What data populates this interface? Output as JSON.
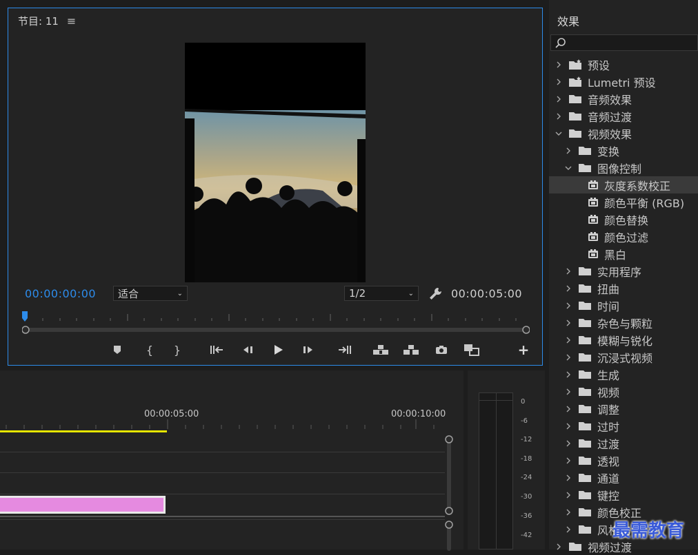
{
  "monitor": {
    "title": "节目: 11",
    "current_timecode": "00:00:00:00",
    "duration_timecode": "00:00:05:00",
    "fit_value": "适合",
    "resolution_value": "1/2"
  },
  "timeline": {
    "tick1": "00:00:05:00",
    "tick2": "00:00:10:00"
  },
  "meter": {
    "labels": [
      "0",
      "-6",
      "-12",
      "-18",
      "-24",
      "-30",
      "-36",
      "-42"
    ]
  },
  "effects": {
    "title": "效果",
    "items": [
      {
        "label": "预设",
        "level": 0,
        "arrow": "right",
        "icon": "star-folder"
      },
      {
        "label": "Lumetri 预设",
        "level": 0,
        "arrow": "right",
        "icon": "star-folder"
      },
      {
        "label": "音频效果",
        "level": 0,
        "arrow": "right",
        "icon": "folder"
      },
      {
        "label": "音频过渡",
        "level": 0,
        "arrow": "right",
        "icon": "folder"
      },
      {
        "label": "视频效果",
        "level": 0,
        "arrow": "down",
        "icon": "folder"
      },
      {
        "label": "变换",
        "level": 1,
        "arrow": "right",
        "icon": "folder"
      },
      {
        "label": "图像控制",
        "level": 1,
        "arrow": "down",
        "icon": "folder"
      },
      {
        "label": "灰度系数校正",
        "level": 2,
        "arrow": "",
        "icon": "effect",
        "selected": true
      },
      {
        "label": "颜色平衡 (RGB)",
        "level": 2,
        "arrow": "",
        "icon": "effect"
      },
      {
        "label": "颜色替换",
        "level": 2,
        "arrow": "",
        "icon": "effect"
      },
      {
        "label": "颜色过滤",
        "level": 2,
        "arrow": "",
        "icon": "effect"
      },
      {
        "label": "黑白",
        "level": 2,
        "arrow": "",
        "icon": "effect"
      },
      {
        "label": "实用程序",
        "level": 1,
        "arrow": "right",
        "icon": "folder"
      },
      {
        "label": "扭曲",
        "level": 1,
        "arrow": "right",
        "icon": "folder"
      },
      {
        "label": "时间",
        "level": 1,
        "arrow": "right",
        "icon": "folder"
      },
      {
        "label": "杂色与颗粒",
        "level": 1,
        "arrow": "right",
        "icon": "folder"
      },
      {
        "label": "模糊与锐化",
        "level": 1,
        "arrow": "right",
        "icon": "folder"
      },
      {
        "label": "沉浸式视频",
        "level": 1,
        "arrow": "right",
        "icon": "folder"
      },
      {
        "label": "生成",
        "level": 1,
        "arrow": "right",
        "icon": "folder"
      },
      {
        "label": "视频",
        "level": 1,
        "arrow": "right",
        "icon": "folder"
      },
      {
        "label": "调整",
        "level": 1,
        "arrow": "right",
        "icon": "folder"
      },
      {
        "label": "过时",
        "level": 1,
        "arrow": "right",
        "icon": "folder"
      },
      {
        "label": "过渡",
        "level": 1,
        "arrow": "right",
        "icon": "folder"
      },
      {
        "label": "透视",
        "level": 1,
        "arrow": "right",
        "icon": "folder"
      },
      {
        "label": "通道",
        "level": 1,
        "arrow": "right",
        "icon": "folder"
      },
      {
        "label": "键控",
        "level": 1,
        "arrow": "right",
        "icon": "folder"
      },
      {
        "label": "颜色校正",
        "level": 1,
        "arrow": "right",
        "icon": "folder"
      },
      {
        "label": "风格化",
        "level": 1,
        "arrow": "right",
        "icon": "folder"
      },
      {
        "label": "视频过渡",
        "level": 0,
        "arrow": "right",
        "icon": "folder"
      }
    ]
  },
  "watermark": "最需教育"
}
